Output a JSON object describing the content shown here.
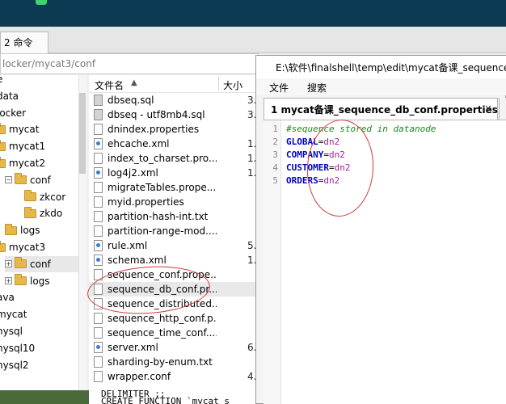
{
  "app": {
    "tab_label": "2 命令",
    "path": "locker/mycat3/conf"
  },
  "tree": {
    "items": [
      {
        "label": "e",
        "indent": 0,
        "folder": false,
        "expander": ""
      },
      {
        "label": "data",
        "indent": 0,
        "folder": false,
        "expander": ""
      },
      {
        "label": "locker",
        "indent": 0,
        "folder": false,
        "expander": ""
      },
      {
        "label": "mycat",
        "indent": 1,
        "folder": true,
        "expander": ""
      },
      {
        "label": "mycat1",
        "indent": 1,
        "folder": true,
        "expander": ""
      },
      {
        "label": "mycat2",
        "indent": 1,
        "folder": true,
        "expander": ""
      },
      {
        "label": "conf",
        "indent": 2,
        "folder": true,
        "expander": "−"
      },
      {
        "label": "zkcor",
        "indent": 3,
        "folder": true,
        "expander": ""
      },
      {
        "label": "zkdo",
        "indent": 3,
        "folder": true,
        "expander": ""
      },
      {
        "label": "logs",
        "indent": 2,
        "folder": true,
        "expander": ""
      },
      {
        "label": "mycat3",
        "indent": 1,
        "folder": true,
        "expander": ""
      },
      {
        "label": "conf",
        "indent": 2,
        "folder": true,
        "expander": "+",
        "selected": true
      },
      {
        "label": "logs",
        "indent": 2,
        "folder": true,
        "expander": "+"
      },
      {
        "label": "ava",
        "indent": 0,
        "folder": false,
        "expander": ""
      },
      {
        "label": "mycat",
        "indent": 0,
        "folder": false,
        "expander": ""
      },
      {
        "label": "nysql",
        "indent": 0,
        "folder": false,
        "expander": ""
      },
      {
        "label": "nysql10",
        "indent": 0,
        "folder": false,
        "expander": ""
      },
      {
        "label": "nysql2",
        "indent": 0,
        "folder": false,
        "expander": ""
      }
    ]
  },
  "files": {
    "header_name": "文件名",
    "header_size": "大小",
    "rows": [
      {
        "name": "dbseq.sql",
        "size": "3.",
        "type": "sql"
      },
      {
        "name": "dbseq - utf8mb4.sql",
        "size": "3.",
        "type": "sql"
      },
      {
        "name": "dnindex.properties",
        "size": "",
        "type": "txt"
      },
      {
        "name": "ehcache.xml",
        "size": "1.",
        "type": "xml"
      },
      {
        "name": "index_to_charset.pro...",
        "size": "1.",
        "type": "txt"
      },
      {
        "name": "log4j2.xml",
        "size": "1.",
        "type": "xml"
      },
      {
        "name": "migrateTables.prope...",
        "size": "",
        "type": "txt"
      },
      {
        "name": "myid.properties",
        "size": "",
        "type": "txt"
      },
      {
        "name": "partition-hash-int.txt",
        "size": "",
        "type": "txt"
      },
      {
        "name": "partition-range-mod....",
        "size": "",
        "type": "txt"
      },
      {
        "name": "rule.xml",
        "size": "5.",
        "type": "xml"
      },
      {
        "name": "schema.xml",
        "size": "1.",
        "type": "xml"
      },
      {
        "name": "sequence_conf.prope...",
        "size": "",
        "type": "txt"
      },
      {
        "name": "sequence_db_conf.pr...",
        "size": "",
        "type": "txt",
        "selected": true
      },
      {
        "name": "sequence_distributed...",
        "size": "",
        "type": "txt"
      },
      {
        "name": "sequence_http_conf.p...",
        "size": "",
        "type": "txt"
      },
      {
        "name": "sequence_time_conf....",
        "size": "",
        "type": "txt"
      },
      {
        "name": "server.xml",
        "size": "6.",
        "type": "xml"
      },
      {
        "name": "sharding-by-enum.txt",
        "size": "",
        "type": "txt"
      },
      {
        "name": "wrapper.conf",
        "size": "4.",
        "type": "txt"
      }
    ]
  },
  "terminal": {
    "line1": "DELIMITER ;;",
    "line2": "CREATE FUNCTION `mycat_s"
  },
  "editor": {
    "title": "E:\\软件\\finalshell\\temp\\edit\\mycat备课_sequence",
    "menu": [
      "文件",
      "搜索"
    ],
    "tab_label": "1 mycat备课_sequence_db_conf.properties",
    "tab_close": "×",
    "lines": [
      {
        "num": "1",
        "comment": "#sequence stored in datanode",
        "key": "",
        "value": ""
      },
      {
        "num": "2",
        "comment": "",
        "key": "GLOBAL",
        "value": "dn2"
      },
      {
        "num": "3",
        "comment": "",
        "key": "COMPANY",
        "value": "dn2"
      },
      {
        "num": "4",
        "comment": "",
        "key": "CUSTOMER",
        "value": "dn2"
      },
      {
        "num": "5",
        "comment": "",
        "key": "ORDERS",
        "value": "dn2"
      }
    ]
  },
  "colors": {
    "annotation": "#d23a3a",
    "key": "#0000c8",
    "value": "#a0209a",
    "comment": "#178a17"
  }
}
